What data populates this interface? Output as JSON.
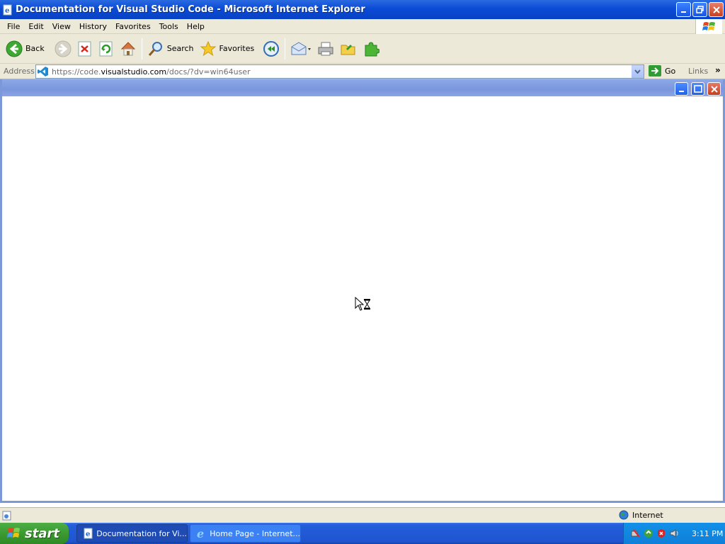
{
  "window": {
    "title": "Documentation for Visual Studio Code - Microsoft Internet Explorer"
  },
  "menu": {
    "items": [
      "File",
      "Edit",
      "View",
      "History",
      "Favorites",
      "Tools",
      "Help"
    ]
  },
  "toolbar": {
    "back_label": "Back",
    "search_label": "Search",
    "favorites_label": "Favorites"
  },
  "address": {
    "label": "Address",
    "url_prefix": "https://code.",
    "url_domain": "visualstudio.com",
    "url_suffix": "/docs/?dv=win64user",
    "go_label": "Go",
    "links_label": "Links"
  },
  "status": {
    "zone_label": "Internet"
  },
  "taskbar": {
    "start_label": "start",
    "tasks": [
      {
        "label": "Documentation for Vi...",
        "active": true
      },
      {
        "label": "Home Page - Internet...",
        "active": false
      }
    ],
    "clock": "3:11 PM"
  },
  "colors": {
    "titlebar": "#0b4bd6",
    "chrome": "#ece9d8",
    "taskbar": "#245edb",
    "start": "#3c9a32",
    "inner_frame": "#7d98d8"
  }
}
